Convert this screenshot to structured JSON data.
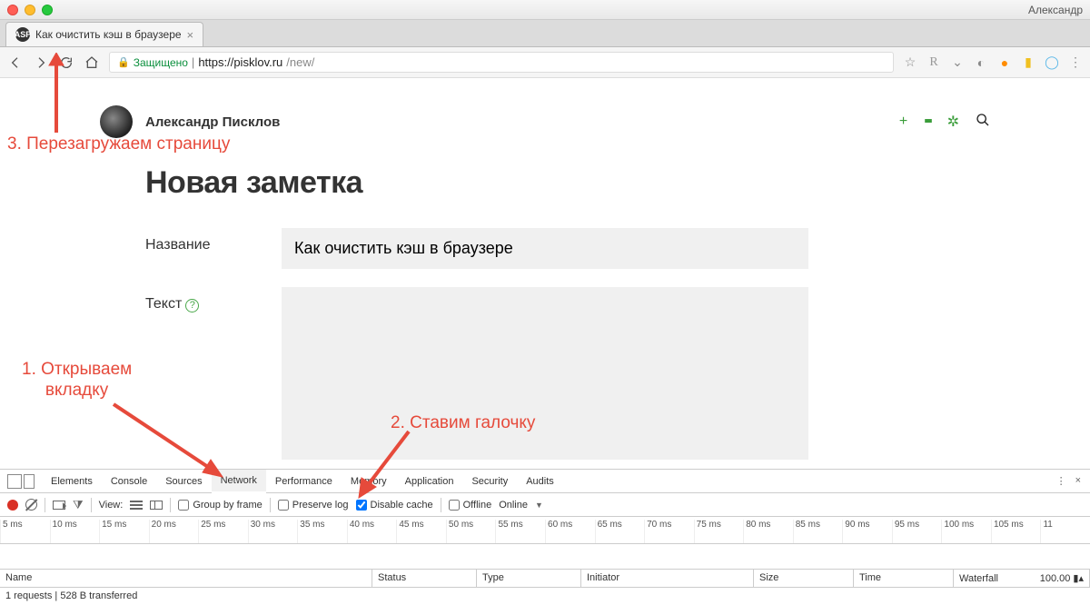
{
  "window": {
    "profile": "Александр"
  },
  "tab": {
    "title": "Как очистить кэш в браузере",
    "favicon_letters": "ASP"
  },
  "urlbar": {
    "secure_label": "Защищено",
    "proto_host": "https://pisklov.ru",
    "path": "/new/"
  },
  "ext_icons": [
    "star",
    "R",
    "pocket",
    "info",
    "orange",
    "stick",
    "cloud",
    "dots"
  ],
  "page": {
    "author": "Александр Писклов",
    "title": "Новая заметка",
    "label_name": "Название",
    "label_text": "Текст",
    "field_name_value": "Как очистить кэш в браузере"
  },
  "devtools": {
    "tabs": [
      "Elements",
      "Console",
      "Sources",
      "Network",
      "Performance",
      "Memory",
      "Application",
      "Security",
      "Audits"
    ],
    "active_tab": "Network",
    "toolbar": {
      "view_label": "View:",
      "group_by_frame": "Group by frame",
      "preserve_log": "Preserve log",
      "disable_cache": "Disable cache",
      "offline": "Offline",
      "online": "Online",
      "disable_cache_checked": true
    },
    "timeline_ticks": [
      "5 ms",
      "10 ms",
      "15 ms",
      "20 ms",
      "25 ms",
      "30 ms",
      "35 ms",
      "40 ms",
      "45 ms",
      "50 ms",
      "55 ms",
      "60 ms",
      "65 ms",
      "70 ms",
      "75 ms",
      "80 ms",
      "85 ms",
      "90 ms",
      "95 ms",
      "100 ms",
      "105 ms",
      "11"
    ],
    "columns": {
      "name": "Name",
      "status": "Status",
      "type": "Type",
      "initiator": "Initiator",
      "size": "Size",
      "time": "Time",
      "waterfall": "Waterfall"
    },
    "wf_value": "100.00",
    "status_line": "1 requests | 528 B transferred"
  },
  "annotations": {
    "a1": "1. Открываем\nвкладку",
    "a2": "2. Ставим галочку",
    "a3": "3. Перезагружаем страницу"
  }
}
